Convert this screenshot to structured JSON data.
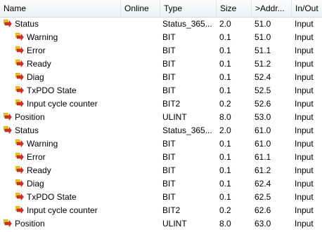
{
  "columns": {
    "name": "Name",
    "online": "Online",
    "type": "Type",
    "size": "Size",
    "address": ">Addr...",
    "inout": "In/Out"
  },
  "colors": {
    "icon_red": "#d83020",
    "icon_yellow": "#f2c418",
    "header_border": "#d5dae3"
  },
  "rows": [
    {
      "name": "Status",
      "level": 0,
      "icon": "input-variable-icon",
      "type": "Status_365...",
      "size": "2.0",
      "address": "51.0",
      "inout": "Input"
    },
    {
      "name": "Warning",
      "level": 1,
      "icon": "input-variable-icon",
      "type": "BIT",
      "size": "0.1",
      "address": "51.0",
      "inout": "Input"
    },
    {
      "name": "Error",
      "level": 1,
      "icon": "input-variable-icon",
      "type": "BIT",
      "size": "0.1",
      "address": "51.1",
      "inout": "Input"
    },
    {
      "name": "Ready",
      "level": 1,
      "icon": "input-variable-icon",
      "type": "BIT",
      "size": "0.1",
      "address": "51.2",
      "inout": "Input"
    },
    {
      "name": "Diag",
      "level": 1,
      "icon": "input-variable-icon",
      "type": "BIT",
      "size": "0.1",
      "address": "52.4",
      "inout": "Input"
    },
    {
      "name": "TxPDO State",
      "level": 1,
      "icon": "input-variable-icon",
      "type": "BIT",
      "size": "0.1",
      "address": "52.5",
      "inout": "Input"
    },
    {
      "name": "Input cycle counter",
      "level": 1,
      "icon": "input-variable-icon",
      "type": "BIT2",
      "size": "0.2",
      "address": "52.6",
      "inout": "Input"
    },
    {
      "name": "Position",
      "level": 0,
      "icon": "input-variable-icon",
      "type": "ULINT",
      "size": "8.0",
      "address": "53.0",
      "inout": "Input"
    },
    {
      "name": "Status",
      "level": 0,
      "icon": "input-variable-icon",
      "type": "Status_365...",
      "size": "2.0",
      "address": "61.0",
      "inout": "Input"
    },
    {
      "name": "Warning",
      "level": 1,
      "icon": "input-variable-icon",
      "type": "BIT",
      "size": "0.1",
      "address": "61.0",
      "inout": "Input"
    },
    {
      "name": "Error",
      "level": 1,
      "icon": "input-variable-icon",
      "type": "BIT",
      "size": "0.1",
      "address": "61.1",
      "inout": "Input"
    },
    {
      "name": "Ready",
      "level": 1,
      "icon": "input-variable-icon",
      "type": "BIT",
      "size": "0.1",
      "address": "61.2",
      "inout": "Input"
    },
    {
      "name": "Diag",
      "level": 1,
      "icon": "input-variable-icon",
      "type": "BIT",
      "size": "0.1",
      "address": "62.4",
      "inout": "Input"
    },
    {
      "name": "TxPDO State",
      "level": 1,
      "icon": "input-variable-icon",
      "type": "BIT",
      "size": "0.1",
      "address": "62.5",
      "inout": "Input"
    },
    {
      "name": "Input cycle counter",
      "level": 1,
      "icon": "input-variable-icon",
      "type": "BIT2",
      "size": "0.2",
      "address": "62.6",
      "inout": "Input"
    },
    {
      "name": "Position",
      "level": 0,
      "icon": "input-variable-icon",
      "type": "ULINT",
      "size": "8.0",
      "address": "63.0",
      "inout": "Input"
    }
  ]
}
